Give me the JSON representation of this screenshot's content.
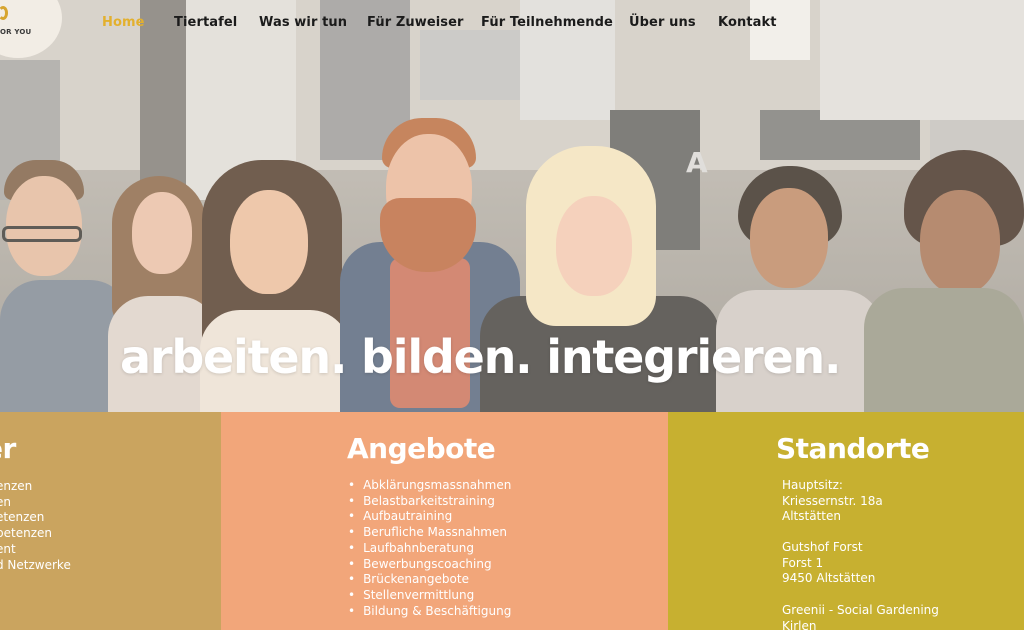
{
  "brand": {
    "logo_text": "OR YOU",
    "accent_color": "#e3b02d"
  },
  "nav": {
    "items": [
      {
        "label": "Home",
        "active": true
      },
      {
        "label": "Tiertafel",
        "active": false
      },
      {
        "label": "Was wir tun",
        "active": false
      },
      {
        "label": "Für Zuweiser",
        "active": false
      },
      {
        "label": "Für Teilnehmende",
        "active": false
      },
      {
        "label": "Über uns",
        "active": false
      },
      {
        "label": "Kontakt",
        "active": false
      }
    ]
  },
  "hero": {
    "headline": "arbeiten. bilden. integrieren.",
    "door_letter": "A"
  },
  "columns": {
    "left": {
      "title": "er",
      "color": "#caa45f",
      "items": [
        "enzen",
        "en",
        "etenzen",
        "petenzen",
        "ent",
        "d Netzwerke"
      ]
    },
    "angebote": {
      "title": "Angebote",
      "color": "#f2a67a",
      "items": [
        "Abklärungsmassnahmen",
        "Belastbarkeitstraining",
        "Aufbautraining",
        "Berufliche Massnahmen",
        "Laufbahnberatung",
        "Bewerbungscoaching",
        "Brückenangebote",
        "Stellenvermittlung",
        "Bildung & Beschäftigung"
      ]
    },
    "standorte": {
      "title": "Standorte",
      "color": "#c7b030",
      "locations": [
        {
          "line1": "Hauptsitz:",
          "line2": "Kriessernstr. 18a",
          "line3": "Altstätten"
        },
        {
          "line1": "Gutshof Forst",
          "line2": "Forst 1",
          "line3": "9450 Altstätten"
        },
        {
          "line1": "Greenii - Social Gardening",
          "line2": "Kirlen",
          "line3": ""
        }
      ]
    }
  }
}
